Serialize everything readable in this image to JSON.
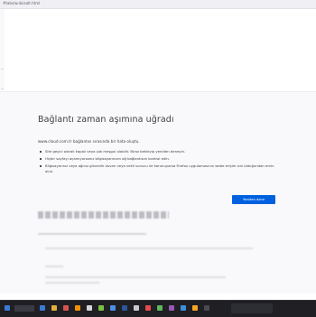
{
  "browser": {
    "url": "#tabs/w.daisalt.html"
  },
  "error": {
    "title": "Bağlantı zaman aşımına uğradı",
    "description": "www.cloud.com.tr bağlantısı sırasında bir hata oluştu.",
    "tips": [
      "Site geçici olarak kapalı veya çok meşgul olabilir. Biraz bekleyip yeniden deneyin.",
      "Hiçbir sayfayı açamıyorsanız bilgisayarınızın ağ bağlantısını kontrol edin.",
      "Bilgisayarınız veya ağınız güvenlik duvarı veya vekil sunucu ile korunuyorsa Firefox uygulamasının webe erişim izni olduğundan emin olun."
    ],
    "retry_label": "Yeniden dene"
  },
  "taskbar": {
    "icon_colors": [
      "#3a7bd5",
      "#e0b03a",
      "#d9534f",
      "#f29100",
      "#d7d7db",
      "#7ac143",
      "#4a90e2",
      "#2b5797",
      "#c9c9d1",
      "#e54b4b",
      "#5fb760",
      "#9b59b6",
      "#3d8fd9",
      "#f5a623",
      "#4a4a52"
    ]
  }
}
